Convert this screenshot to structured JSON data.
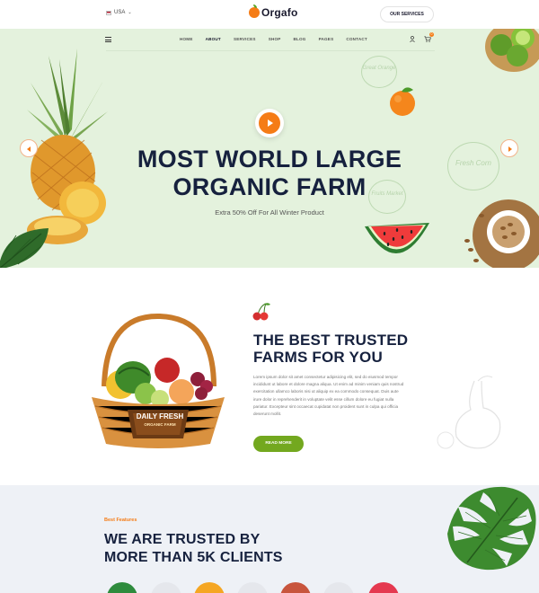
{
  "topbar": {
    "language": "USA",
    "brand": "Orgafo",
    "services_button": "OUR SERVICES"
  },
  "nav": {
    "items": [
      {
        "label": "HOME",
        "active": false
      },
      {
        "label": "ABOUT",
        "active": true
      },
      {
        "label": "SERVICES",
        "active": false
      },
      {
        "label": "SHOP",
        "active": false
      },
      {
        "label": "BLOG",
        "active": false
      },
      {
        "label": "PAGES",
        "active": false
      },
      {
        "label": "CONTACT",
        "active": false
      }
    ],
    "cart_count": "0"
  },
  "hero": {
    "title_line1": "MOST WORLD LARGE",
    "title_line2": "ORGANIC FARM",
    "subtitle": "Extra 50% Off For All Winter Product",
    "bubbles": [
      "Great Orange",
      "Fresh Corn",
      "Fruits Market"
    ]
  },
  "about": {
    "title_line1": "THE BEST TRUSTED",
    "title_line2": "FARMS FOR YOU",
    "body": "Lorem ipsum dolor sit amet consectetur adipisicing elit, sed do eiusmod tempor incididunt ut labore et dolore magna aliqua. Ut enim ad minim veniam quis nostrud exercitation ullamco laboris nisi ut aliquip ex ea commodo consequat. Duis aute irure dolor in reprehenderit in voluptate velit esse cillum dolore eu fugiat nulla pariatur. Excepteur sint occaecat cupidatat non proident sunt in culpa qui officia deserunt mollit.",
    "button": "READ MORE",
    "basket_label_line1": "DAILY FRESH",
    "basket_label_line2": "ORGANIC FARM"
  },
  "features": {
    "label": "Best Features",
    "title_line1": "WE ARE TRUSTED BY",
    "title_line2": "MORE THAN 5K CLIENTS"
  },
  "colors": {
    "accent": "#f57c16",
    "green": "#73a81f",
    "hero_bg": "#e4f2dd",
    "heading": "#16213e"
  }
}
